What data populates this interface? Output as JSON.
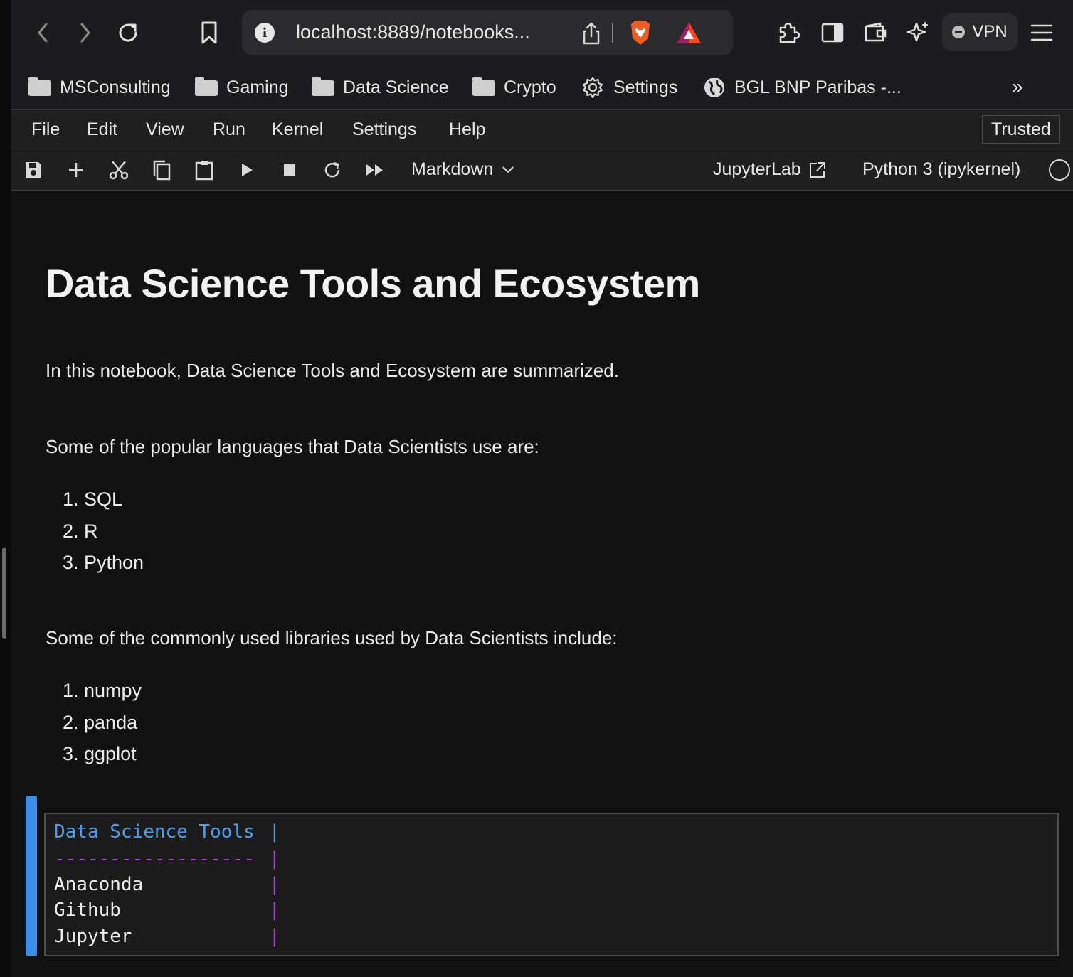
{
  "browser": {
    "url": "localhost:8889/notebooks...",
    "vpn_label": "VPN",
    "bookmarks": [
      {
        "label": "MSConsulting",
        "icon": "folder-icon"
      },
      {
        "label": "Gaming",
        "icon": "folder-icon"
      },
      {
        "label": "Data Science",
        "icon": "folder-icon"
      },
      {
        "label": "Crypto",
        "icon": "folder-icon"
      },
      {
        "label": "Settings",
        "icon": "gear-icon"
      },
      {
        "label": "BGL BNP Paribas -...",
        "icon": "globe-icon"
      }
    ],
    "more_label": "»"
  },
  "jupyter": {
    "menu": [
      "File",
      "Edit",
      "View",
      "Run",
      "Kernel",
      "Settings",
      "Help"
    ],
    "trusted_label": "Trusted",
    "cell_type": "Markdown",
    "jupyterlab_label": "JupyterLab",
    "kernel_name": "Python 3 (ipykernel)"
  },
  "notebook": {
    "title": "Data Science Tools and Ecosystem",
    "intro": "In this notebook, Data Science Tools and Ecosystem are summarized.",
    "languages_heading": "Some of the popular languages that Data Scientists use are:",
    "languages": [
      "1. SQL",
      "2. R",
      "3. Python"
    ],
    "libraries_heading": "Some of the commonly used libraries used by Data Scientists include:",
    "libraries": [
      "1. numpy",
      "2. panda",
      "3. ggplot"
    ],
    "code_cell": {
      "header": "Data Science Tools",
      "separator": "------------------",
      "rows": [
        "Anaconda",
        "Github",
        "Jupyter"
      ],
      "pipe": "|"
    }
  },
  "colors": {
    "accent": "#3b8eea",
    "code_header": "#4d9de8",
    "code_separator": "#b03fe0"
  }
}
